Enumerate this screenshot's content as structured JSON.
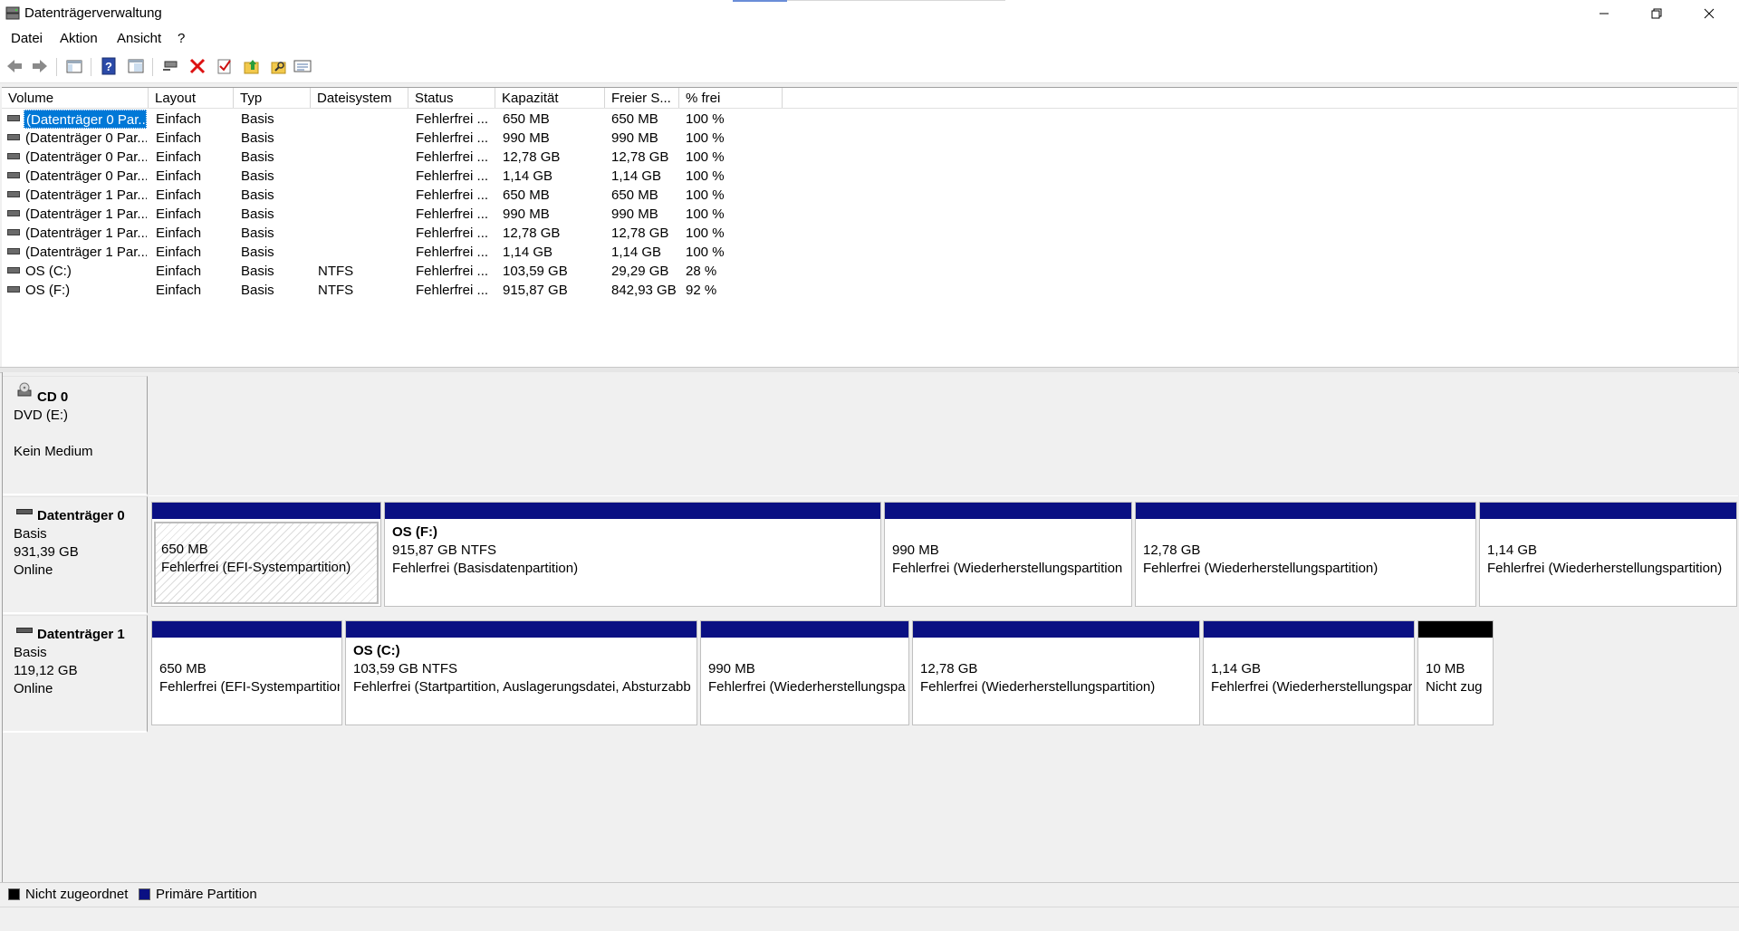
{
  "window": {
    "title": "Datenträgerverwaltung"
  },
  "menu": [
    "Datei",
    "Aktion",
    "Ansicht",
    "?"
  ],
  "toolbar": [
    "back-icon",
    "forward-icon",
    "console-tree-icon",
    "help-icon",
    "show-pane-icon",
    "connect-icon",
    "delete-icon",
    "check-icon",
    "folder-up-icon",
    "search-folder-icon",
    "properties-icon"
  ],
  "volume_table": {
    "columns": [
      "Volume",
      "Layout",
      "Typ",
      "Dateisystem",
      "Status",
      "Kapazität",
      "Freier S...",
      "% frei"
    ],
    "rows": [
      [
        "(Datenträger 0 Par...",
        "Einfach",
        "Basis",
        "",
        "Fehlerfrei ...",
        "650 MB",
        "650 MB",
        "100 %"
      ],
      [
        "(Datenträger 0 Par...",
        "Einfach",
        "Basis",
        "",
        "Fehlerfrei ...",
        "990 MB",
        "990 MB",
        "100 %"
      ],
      [
        "(Datenträger 0 Par...",
        "Einfach",
        "Basis",
        "",
        "Fehlerfrei ...",
        "12,78 GB",
        "12,78 GB",
        "100 %"
      ],
      [
        "(Datenträger 0 Par...",
        "Einfach",
        "Basis",
        "",
        "Fehlerfrei ...",
        "1,14 GB",
        "1,14 GB",
        "100 %"
      ],
      [
        "(Datenträger 1 Par...",
        "Einfach",
        "Basis",
        "",
        "Fehlerfrei ...",
        "650 MB",
        "650 MB",
        "100 %"
      ],
      [
        "(Datenträger 1 Par...",
        "Einfach",
        "Basis",
        "",
        "Fehlerfrei ...",
        "990 MB",
        "990 MB",
        "100 %"
      ],
      [
        "(Datenträger 1 Par...",
        "Einfach",
        "Basis",
        "",
        "Fehlerfrei ...",
        "12,78 GB",
        "12,78 GB",
        "100 %"
      ],
      [
        "(Datenträger 1 Par...",
        "Einfach",
        "Basis",
        "",
        "Fehlerfrei ...",
        "1,14 GB",
        "1,14 GB",
        "100 %"
      ],
      [
        "OS (C:)",
        "Einfach",
        "Basis",
        "NTFS",
        "Fehlerfrei ...",
        "103,59 GB",
        "29,29 GB",
        "28 %"
      ],
      [
        "OS (F:)",
        "Einfach",
        "Basis",
        "NTFS",
        "Fehlerfrei ...",
        "915,87 GB",
        "842,93 GB",
        "92 %"
      ]
    ]
  },
  "disks": {
    "cd0": {
      "name": "CD 0",
      "line1": "DVD (E:)",
      "line2": "",
      "line3": "Kein Medium"
    },
    "disk0": {
      "name": "Datenträger 0",
      "line1": "Basis",
      "line2": "931,39 GB",
      "line3": "Online",
      "partitions": [
        {
          "title": "",
          "size": "650 MB",
          "status": "Fehlerfrei (EFI-Systempartition)"
        },
        {
          "title": "OS  (F:)",
          "size": "915,87 GB NTFS",
          "status": "Fehlerfrei (Basisdatenpartition)"
        },
        {
          "title": "",
          "size": "990 MB",
          "status": "Fehlerfrei (Wiederherstellungspartition"
        },
        {
          "title": "",
          "size": "12,78 GB",
          "status": "Fehlerfrei (Wiederherstellungspartition)"
        },
        {
          "title": "",
          "size": "1,14 GB",
          "status": "Fehlerfrei (Wiederherstellungspartition)"
        }
      ]
    },
    "disk1": {
      "name": "Datenträger 1",
      "line1": "Basis",
      "line2": "119,12 GB",
      "line3": "Online",
      "partitions": [
        {
          "title": "",
          "size": "650 MB",
          "status": "Fehlerfrei (EFI-Systempartition"
        },
        {
          "title": "OS  (C:)",
          "size": "103,59 GB NTFS",
          "status": "Fehlerfrei (Startpartition, Auslagerungsdatei, Absturzabb"
        },
        {
          "title": "",
          "size": "990 MB",
          "status": "Fehlerfrei (Wiederherstellungspa"
        },
        {
          "title": "",
          "size": "12,78 GB",
          "status": "Fehlerfrei (Wiederherstellungspartition)"
        },
        {
          "title": "",
          "size": "1,14 GB",
          "status": "Fehlerfrei (Wiederherstellungspar"
        },
        {
          "title": "",
          "size": "10 MB",
          "status": "Nicht zug"
        }
      ]
    }
  },
  "legend": {
    "unallocated": "Nicht zugeordnet",
    "primary": "Primäre Partition",
    "unallocated_color": "#000000",
    "primary_color": "#0a1083"
  }
}
